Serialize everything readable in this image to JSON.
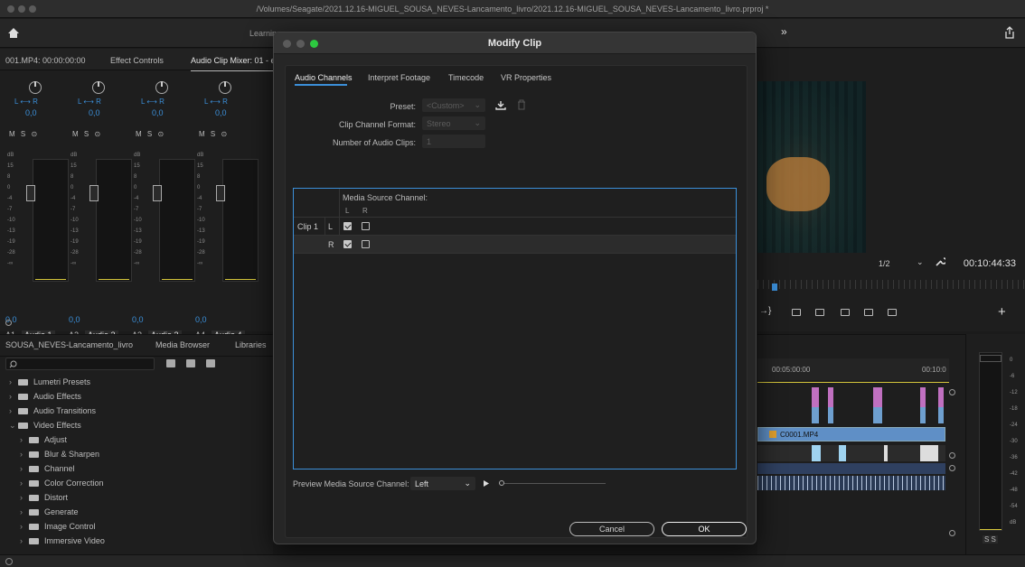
{
  "window": {
    "title": "/Volumes/Seagate/2021.12.16-MIGUEL_SOUSA_NEVES-Lancamento_livro/2021.12.16-MIGUEL_SOUSA_NEVES-Lancamento_livro.prproj *"
  },
  "topbar": {
    "workspace_visible": "Learnin",
    "more_label": "»"
  },
  "mixer_panel": {
    "tabs": [
      "001.MP4: 00:00:00:00",
      "Effect Controls",
      "Audio Clip Mixer: 01 - ec"
    ],
    "active_tab": 2,
    "strips": [
      {
        "lr": "L ⟷ R",
        "pan": "0,0",
        "msb": "M S ⊙",
        "value": "0,0",
        "track": "A1",
        "name": "Audio 1"
      },
      {
        "lr": "L ⟷ R",
        "pan": "0,0",
        "msb": "M S ⊙",
        "value": "0,0",
        "track": "A2",
        "name": "Audio 2"
      },
      {
        "lr": "L ⟷ R",
        "pan": "0,0",
        "msb": "M S ⊙",
        "value": "0,0",
        "track": "A3",
        "name": "Audio 3"
      },
      {
        "lr": "L ⟷ R",
        "pan": "0,0",
        "msb": "M S ⊙",
        "value": "0,0",
        "track": "A4",
        "name": "Audio 4"
      }
    ],
    "db_scale": "dB\n15\n8\n0\n-4\n-7\n-10\n-13\n-19\n-28\n-∞"
  },
  "effects_panel": {
    "tabs": [
      "SOUSA_NEVES-Lancamento_livro",
      "Media Browser",
      "Libraries"
    ],
    "items": [
      {
        "label": "Lumetri Presets",
        "expanded": false,
        "indent": 0
      },
      {
        "label": "Audio Effects",
        "expanded": false,
        "indent": 0
      },
      {
        "label": "Audio Transitions",
        "expanded": false,
        "indent": 0
      },
      {
        "label": "Video Effects",
        "expanded": true,
        "indent": 0
      },
      {
        "label": "Adjust",
        "expanded": false,
        "indent": 1
      },
      {
        "label": "Blur & Sharpen",
        "expanded": false,
        "indent": 1
      },
      {
        "label": "Channel",
        "expanded": false,
        "indent": 1
      },
      {
        "label": "Color Correction",
        "expanded": false,
        "indent": 1
      },
      {
        "label": "Distort",
        "expanded": false,
        "indent": 1
      },
      {
        "label": "Generate",
        "expanded": false,
        "indent": 1
      },
      {
        "label": "Image Control",
        "expanded": false,
        "indent": 1
      },
      {
        "label": "Immersive Video",
        "expanded": false,
        "indent": 1
      }
    ]
  },
  "program_monitor": {
    "resolution": "1/2",
    "timecode": "00:10:44:33"
  },
  "timeline": {
    "marks": [
      "00:05:00:00",
      "00:10:0"
    ],
    "video_clip": "C0001.MP4"
  },
  "vu_meter": {
    "labels": [
      "0",
      "-6",
      "-12",
      "-18",
      "-24",
      "-30",
      "-36",
      "-42",
      "-48",
      "-54",
      "dB"
    ],
    "solo_labels": "S  S"
  },
  "dialog": {
    "title": "Modify Clip",
    "tabs": [
      "Audio Channels",
      "Interpret Footage",
      "Timecode",
      "VR Properties"
    ],
    "active_tab": 0,
    "preset_label": "Preset:",
    "preset_value": "<Custom>",
    "format_label": "Clip Channel Format:",
    "format_value": "Stereo",
    "num_clips_label": "Number of Audio Clips:",
    "num_clips_value": "1",
    "grid": {
      "header": "Media Source Channel:",
      "col_l": "L",
      "col_r": "R",
      "clip_label": "Clip 1",
      "rows": [
        {
          "channel": "L",
          "l_checked": true,
          "r_checked": false
        },
        {
          "channel": "R",
          "l_checked": true,
          "r_checked": false
        }
      ]
    },
    "preview_label": "Preview Media Source Channel:",
    "preview_value": "Left",
    "cancel_label": "Cancel",
    "ok_label": "OK"
  }
}
